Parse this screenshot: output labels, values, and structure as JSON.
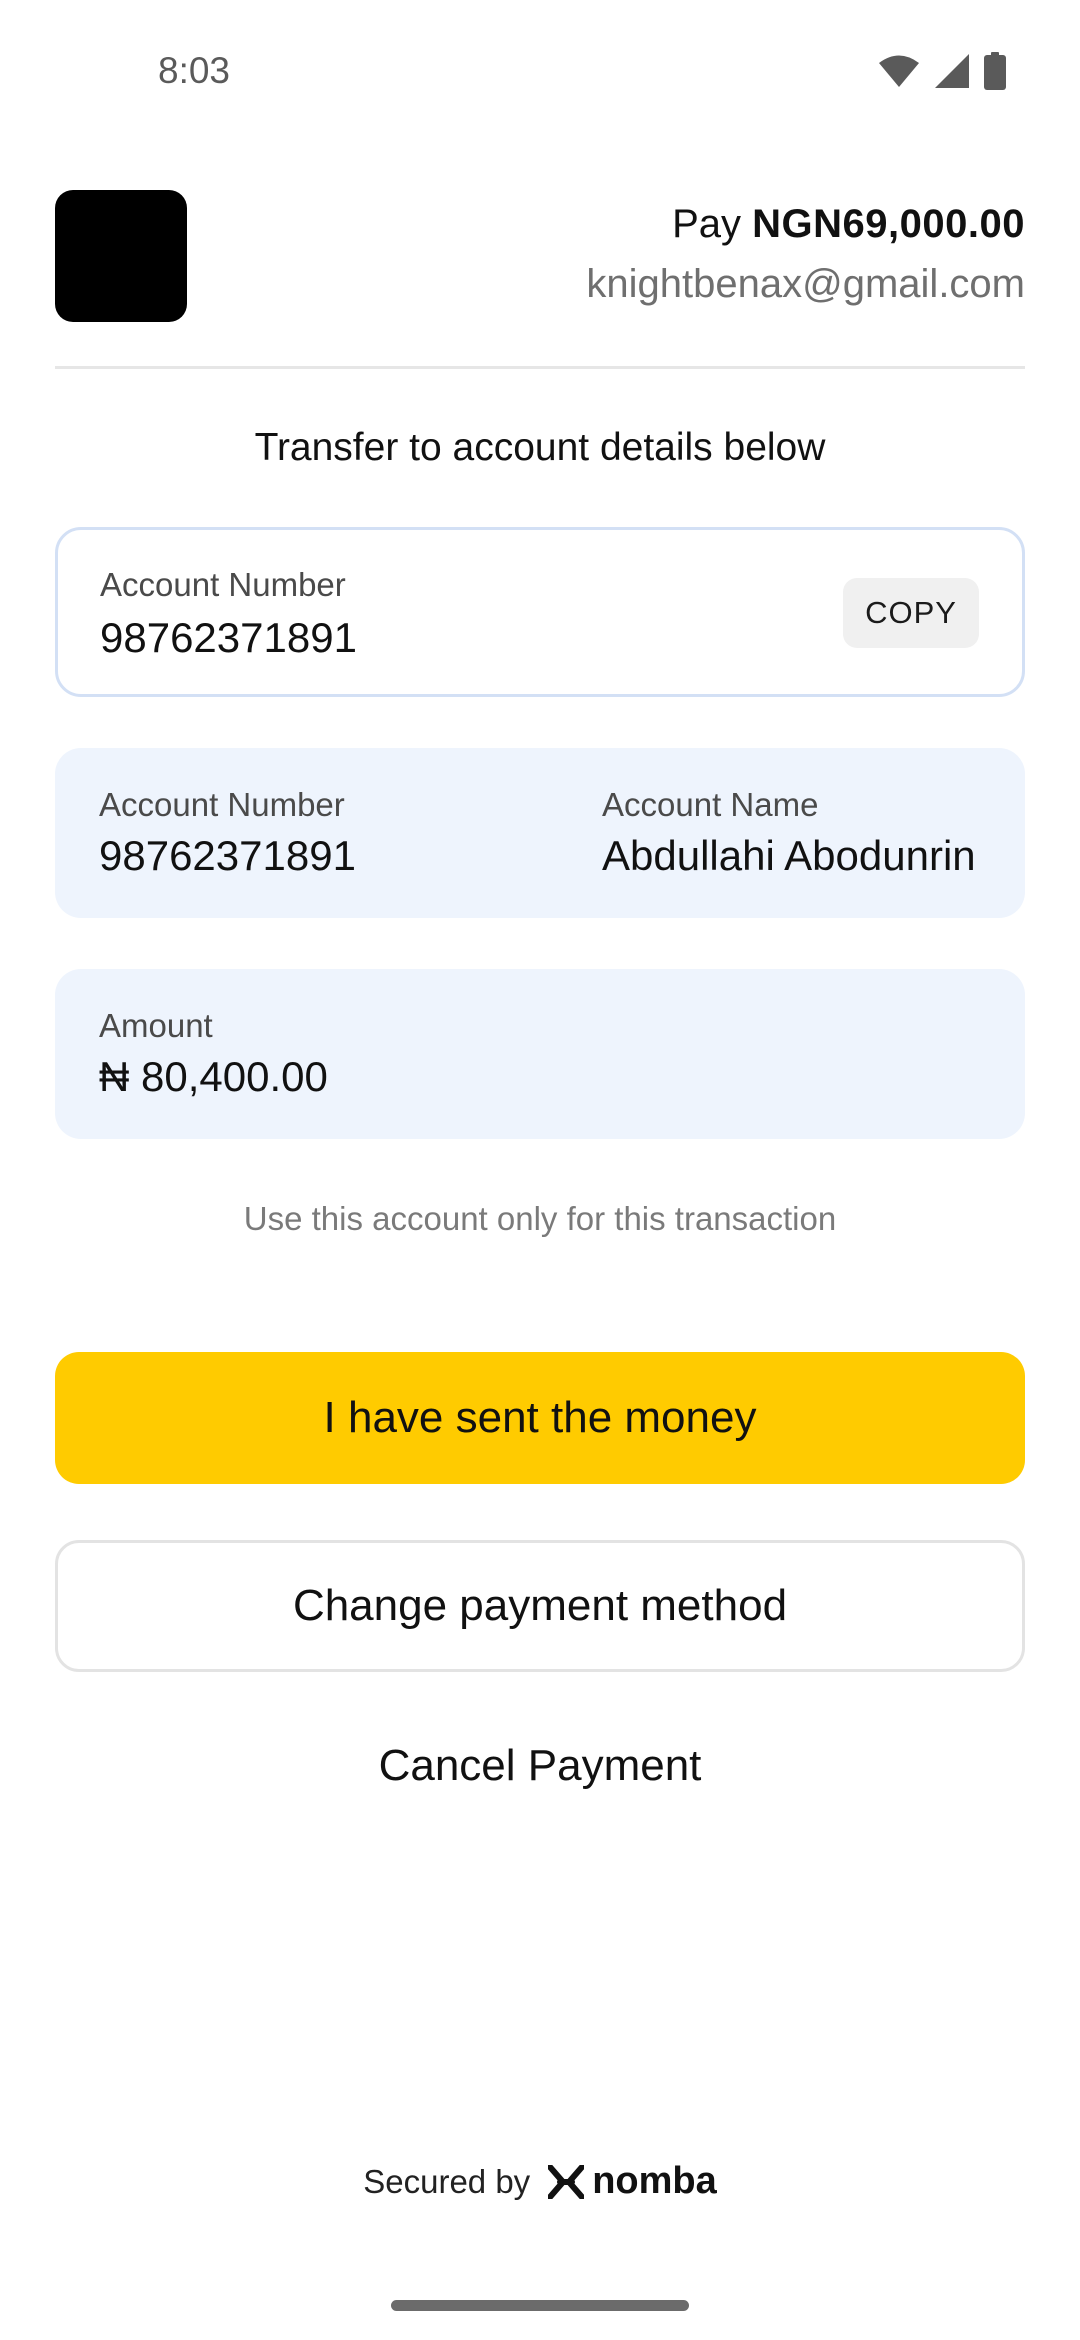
{
  "status_bar": {
    "time": "8:03",
    "icons": [
      "wifi-icon",
      "signal-icon",
      "battery-icon"
    ]
  },
  "header": {
    "pay_label": "Pay",
    "pay_amount": "NGN69,000.00",
    "email": "knightbenax@gmail.com"
  },
  "instruction": "Transfer to account details below",
  "account_card": {
    "label": "Account Number",
    "value": "98762371891",
    "copy_label": "COPY"
  },
  "details_card": {
    "account_number_label": "Account Number",
    "account_number_value": "98762371891",
    "account_name_label": "Account Name",
    "account_name_value": "Abdullahi Abodunrin"
  },
  "amount_card": {
    "label": "Amount",
    "value": "₦ 80,400.00"
  },
  "note": "Use this account only for this transaction",
  "buttons": {
    "sent": "I have sent the money",
    "change": "Change payment method",
    "cancel": "Cancel Payment"
  },
  "footer": {
    "secured_label": "Secured by",
    "brand": "nomba"
  },
  "colors": {
    "primary_button": "#ffcb00",
    "card_fill": "#eef4fd",
    "card_outline": "#d3e0f5"
  }
}
